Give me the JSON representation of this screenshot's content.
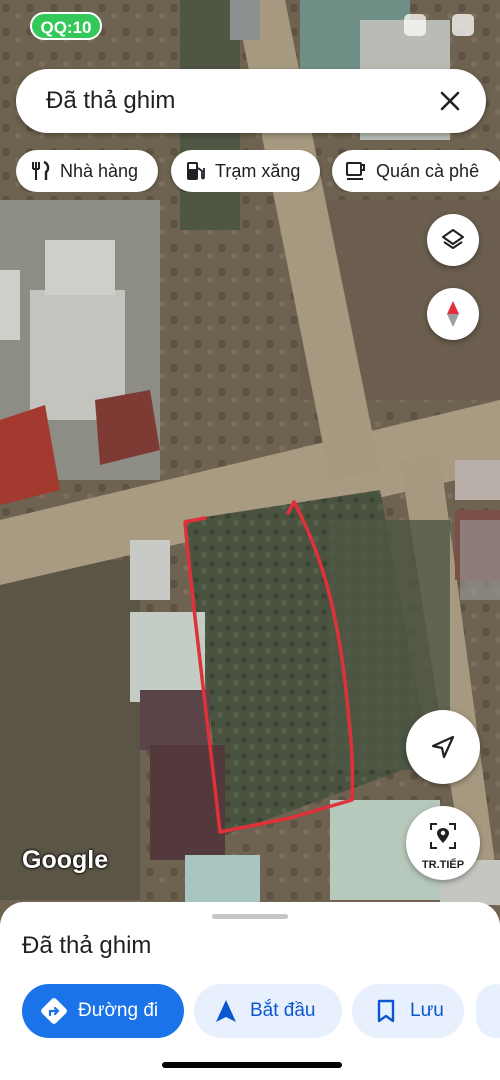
{
  "status_bar": {
    "time": "QQ:10"
  },
  "search": {
    "query": "Đã thả ghim",
    "close_icon": "close-icon"
  },
  "filter_chips": [
    {
      "label": "Nhà hàng",
      "icon": "restaurant-icon"
    },
    {
      "label": "Trạm xăng",
      "icon": "gas-station-icon"
    },
    {
      "label": "Quán cà phê",
      "icon": "coffee-icon"
    }
  ],
  "map_controls": {
    "layers_icon": "layers-icon",
    "compass_icon": "compass-icon",
    "location_icon": "my-location-icon",
    "navigate_label": "TR.TIẾP"
  },
  "map": {
    "attribution": "Google",
    "annotation_color": "#e0313a"
  },
  "bottom_sheet": {
    "title": "Đã thả ghim",
    "actions": [
      {
        "label": "Đường đi",
        "icon": "directions-icon",
        "style": "primary"
      },
      {
        "label": "Bắt đầu",
        "icon": "navigation-arrow-icon",
        "style": "secondary"
      },
      {
        "label": "Lưu",
        "icon": "bookmark-icon",
        "style": "secondary"
      }
    ]
  },
  "colors": {
    "accent": "#1a73e8",
    "accent_light": "#e8f0fe",
    "status_green": "#34c759"
  }
}
